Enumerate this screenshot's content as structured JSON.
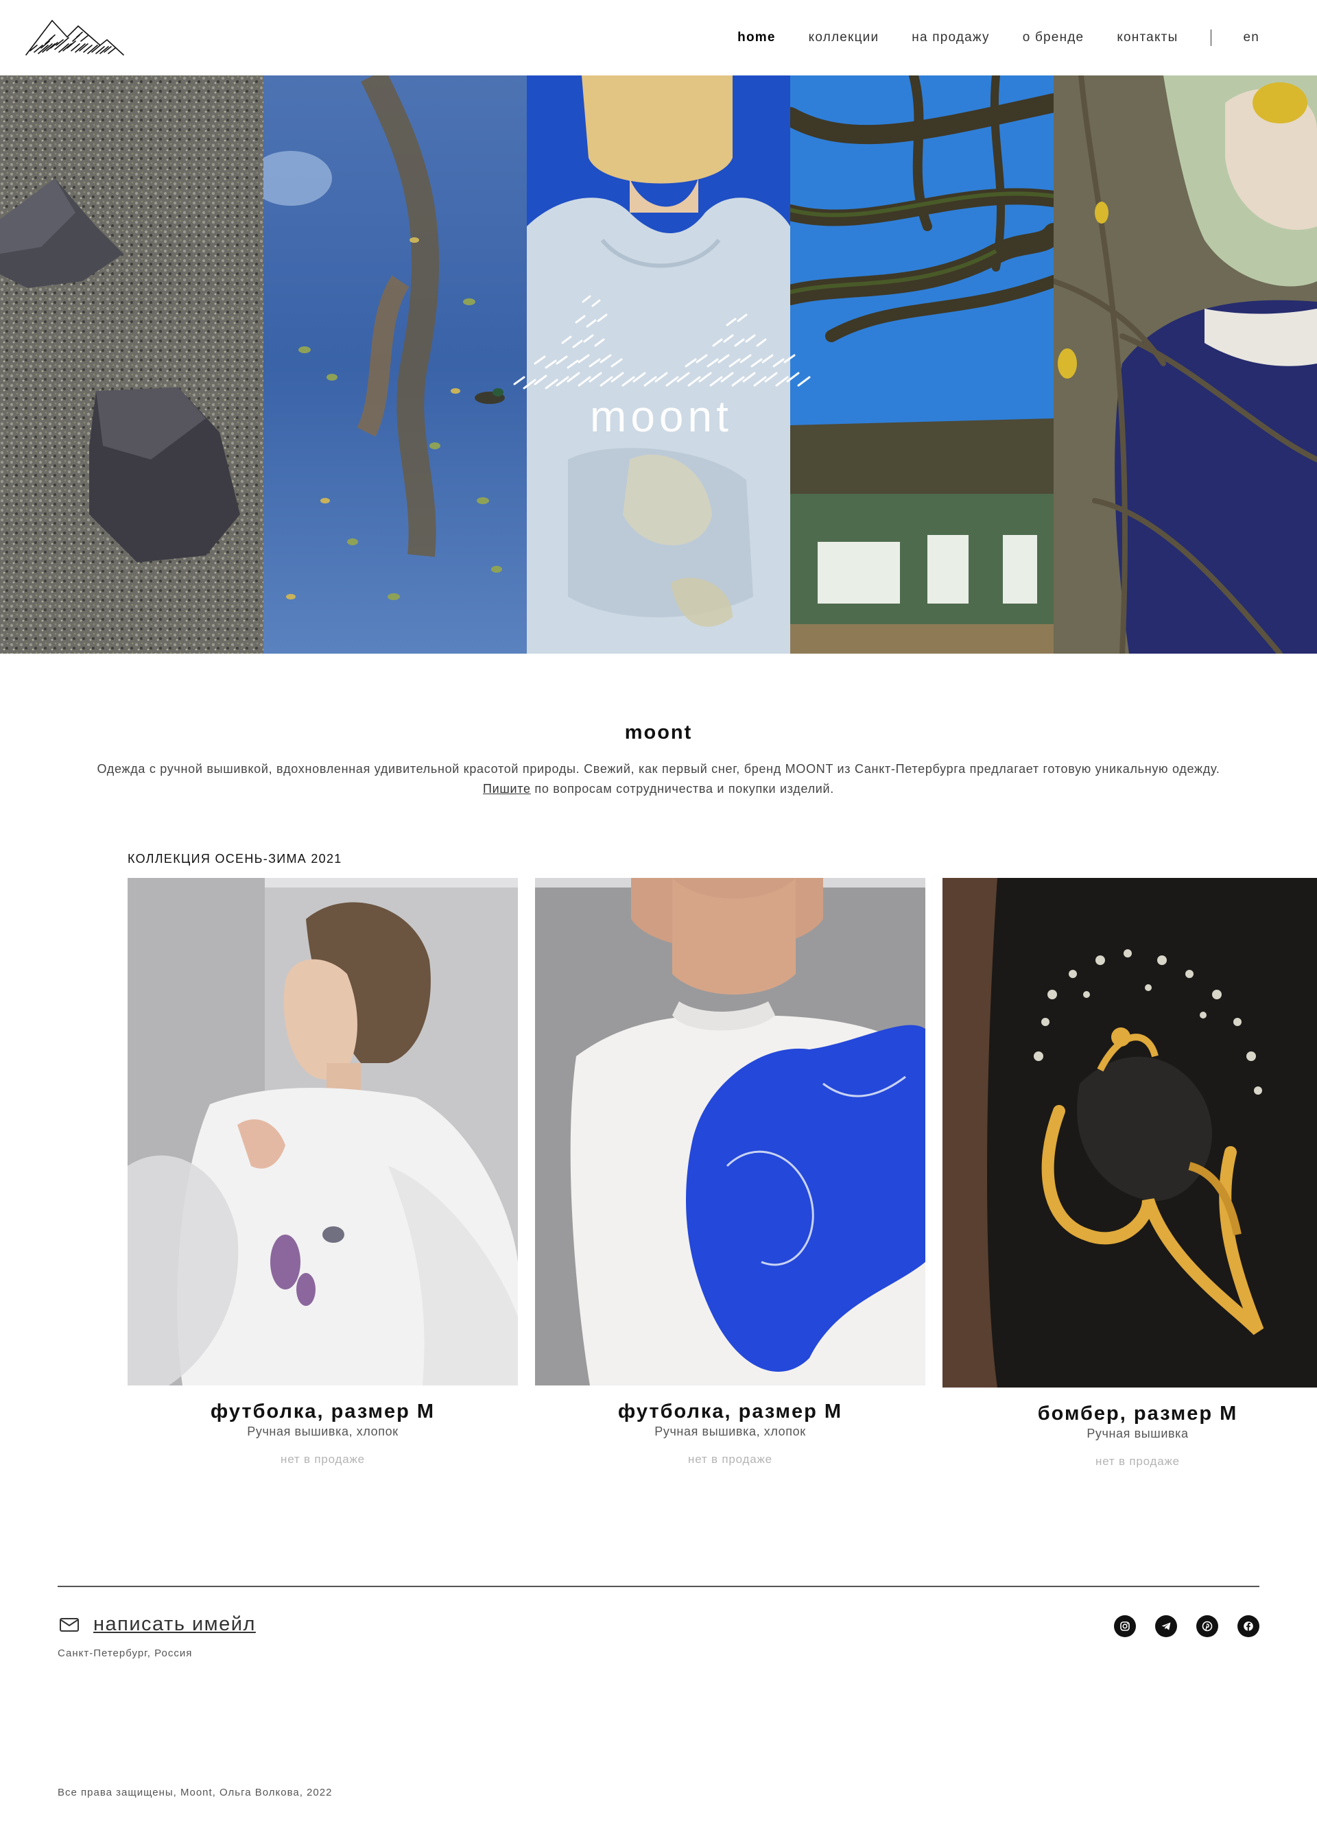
{
  "header": {
    "logo": "mountain-logo",
    "nav": [
      {
        "label": "home",
        "active": true
      },
      {
        "label": "коллекции",
        "active": false
      },
      {
        "label": "на продажу",
        "active": false
      },
      {
        "label": "о бренде",
        "active": false
      },
      {
        "label": "контакты",
        "active": false
      }
    ],
    "lang": "en"
  },
  "hero": {
    "panels": [
      "stones-on-gravel",
      "water-reflection-leaves",
      "embroidered-hoodie",
      "tree-branches-house",
      "person-autumn-branches"
    ],
    "brand_word": "moont"
  },
  "intro": {
    "title": "moont",
    "text_line1": "Одежда с ручной вышивкой, вдохновленная удивительной красотой природы. Свежий, как первый снег, бренд MOONT из Санкт-Петербурга предлагает готовую уникальную одежду.",
    "link": "Пишите",
    "text_line2_rest": " по вопросам сотрудничества и покупки изделий."
  },
  "collection": {
    "title": "КОЛЛЕКЦИЯ ОСЕНЬ-ЗИМА 2021",
    "items": [
      {
        "name": "футболка, размер М",
        "desc": "Ручная вышивка, хлопок",
        "status": "нет в продаже",
        "photo": "woman-white-tshirt-tulle"
      },
      {
        "name": "футболка, размер М",
        "desc": "Ручная вышивка, хлопок",
        "status": "нет в продаже",
        "photo": "boy-blue-embroidery-tshirt"
      },
      {
        "name": "бомбер, размер М",
        "desc": "Ручная вышивка",
        "status": "нет в продаже",
        "photo": "black-bomber-gold-embroidery"
      }
    ]
  },
  "footer": {
    "email_label": "написать имейл",
    "city": "Санкт-Петербург, Россия",
    "socials": [
      "instagram-icon",
      "telegram-icon",
      "pinterest-icon",
      "facebook-icon"
    ],
    "copyright": "Все права защищены, Moont, Ольга Волкова, 2022"
  }
}
